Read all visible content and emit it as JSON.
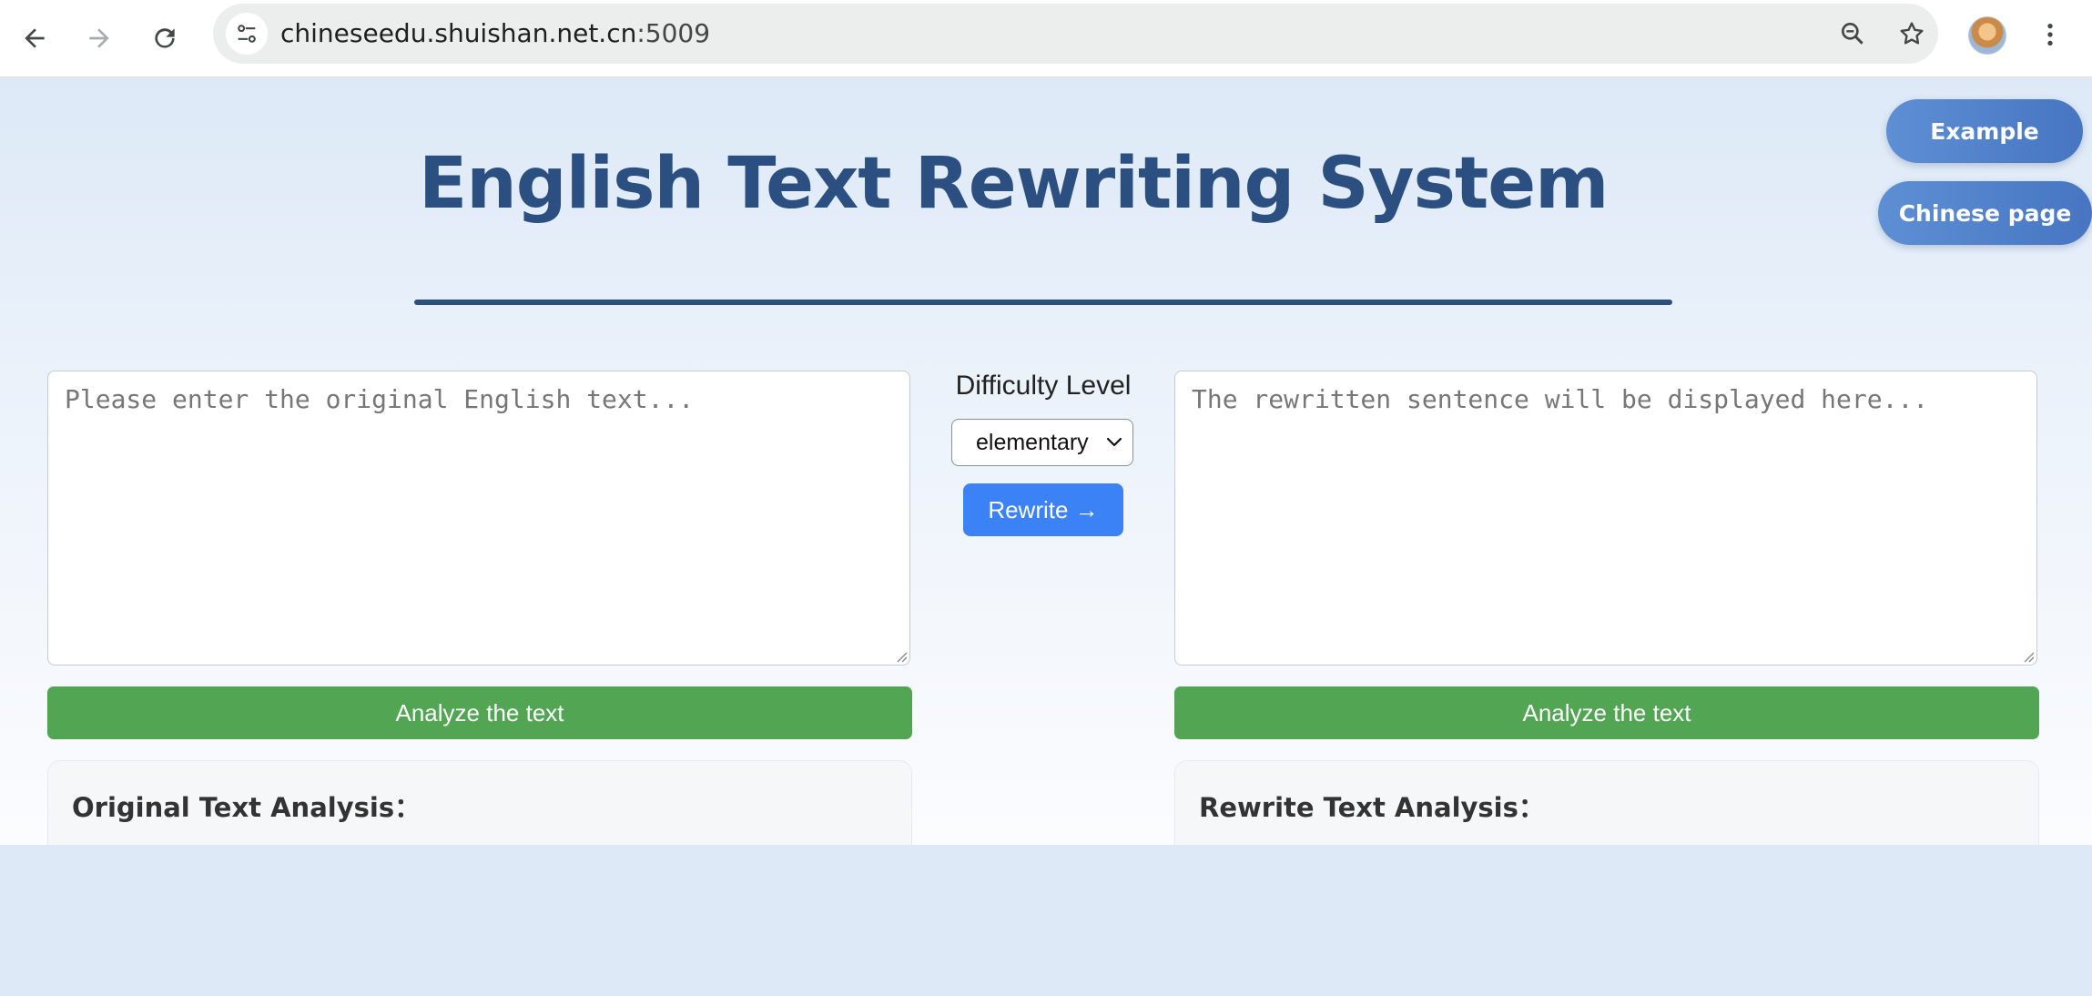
{
  "browser": {
    "url_host": "chineseedu.shuishan.net.cn",
    "url_port": ":5009",
    "icons": [
      "back-arrow-icon",
      "forward-arrow-icon",
      "reload-icon",
      "site-settings-icon",
      "zoom-icon",
      "bookmark-star-icon",
      "profile-avatar",
      "more-vert-icon"
    ]
  },
  "header": {
    "title": "English Text Rewriting System"
  },
  "floating": {
    "example_label": "Example",
    "chinese_label": "Chinese page"
  },
  "input": {
    "placeholder": "Please enter the original English text...",
    "value": ""
  },
  "output": {
    "placeholder": "The rewritten sentence will be displayed here...",
    "value": ""
  },
  "controls": {
    "difficulty_label": "Difficulty Level",
    "difficulty_selected": "elementary",
    "rewrite_label": "Rewrite →"
  },
  "analysis": {
    "analyze_left_label": "Analyze the text",
    "analyze_right_label": "Analyze the text",
    "original_heading": "Original Text Analysis：",
    "rewrite_heading": "Rewrite Text Analysis："
  },
  "colors": {
    "title": "#2b4f80",
    "primary_blue": "#3b82f6",
    "analyze_green": "#52a653",
    "pill_blue": "#4f80c9"
  }
}
